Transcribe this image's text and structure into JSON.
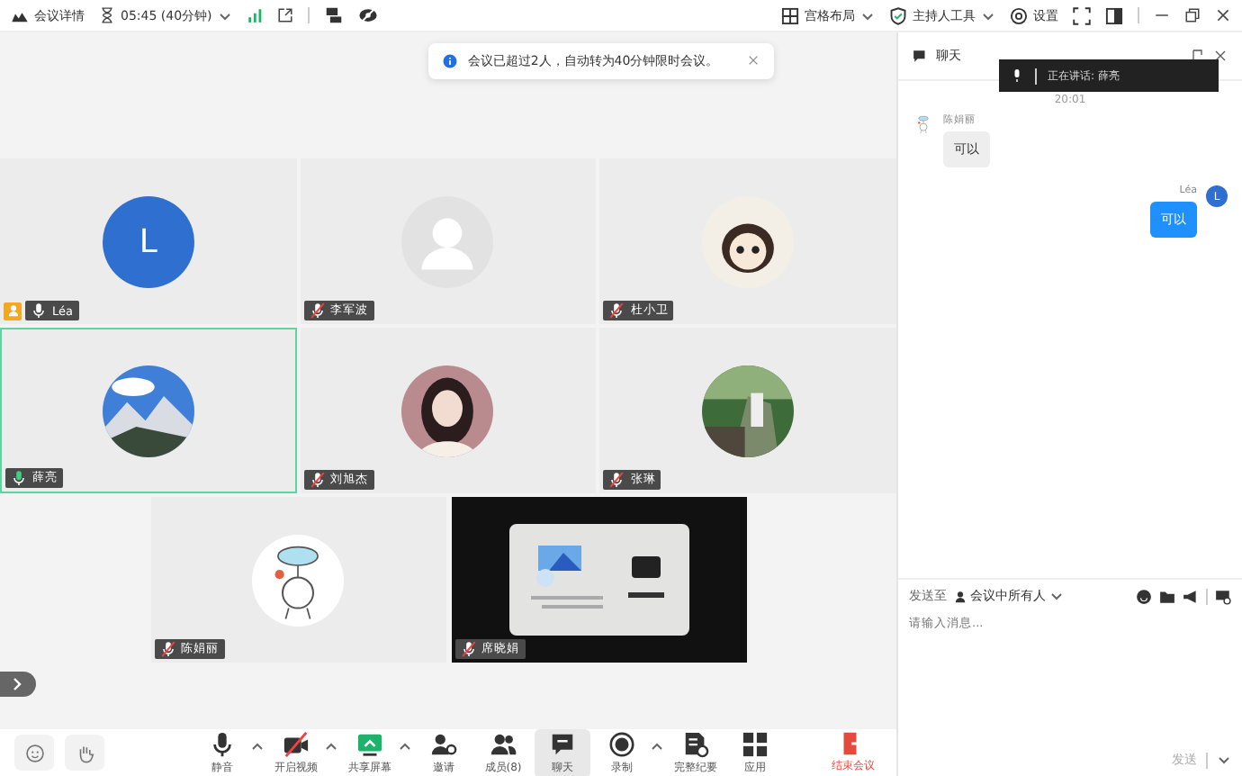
{
  "top_bar": {
    "meeting_info": "会议详情",
    "timer": "05:45 (40分钟)",
    "right_items": [
      {
        "label": "宫格布局"
      },
      {
        "label": "主持人工具"
      },
      {
        "label": "设置"
      }
    ]
  },
  "notice": {
    "text": "会议已超过2人，自动转为40分钟限时会议。"
  },
  "tiles": [
    {
      "name": "Léa",
      "kind": "letter",
      "letter": "L",
      "muted": false,
      "host": true,
      "speaking": false
    },
    {
      "name": "李军波",
      "kind": "default",
      "muted": true,
      "host": false,
      "speaking": false
    },
    {
      "name": "杜小卫",
      "kind": "picture",
      "muted": true,
      "host": false,
      "speaking": false
    },
    {
      "name": "薛亮",
      "kind": "picture",
      "muted": false,
      "host": false,
      "speaking": true
    },
    {
      "name": "刘旭杰",
      "kind": "picture",
      "muted": true,
      "host": false,
      "speaking": false
    },
    {
      "name": "张琳",
      "kind": "picture",
      "muted": true,
      "host": false,
      "speaking": false
    },
    {
      "name": "陈娟丽",
      "kind": "picture",
      "muted": true,
      "host": false,
      "speaking": false
    },
    {
      "name": "席晓娟",
      "kind": "screen",
      "muted": true,
      "host": false,
      "speaking": false
    }
  ],
  "toolbar": [
    {
      "label": "静音",
      "menu": true,
      "selected": false
    },
    {
      "label": "开启视频",
      "menu": true,
      "selected": false
    },
    {
      "label": "共享屏幕",
      "menu": true,
      "selected": false
    },
    {
      "label": "邀请",
      "menu": false,
      "selected": false
    },
    {
      "label": "成员(8)",
      "menu": false,
      "selected": false
    },
    {
      "label": "聊天",
      "menu": false,
      "selected": true
    },
    {
      "label": "录制",
      "menu": true,
      "selected": false
    },
    {
      "label": "完整纪要",
      "menu": false,
      "selected": false
    },
    {
      "label": "应用",
      "menu": false,
      "selected": false
    }
  ],
  "end_button": {
    "label": "结束会议"
  },
  "chat": {
    "title": "聊天",
    "speaking_toast": {
      "label": "正在讲话:",
      "name": "薛亮"
    },
    "time": "20:01",
    "messages": [
      {
        "sender": "陈娟丽",
        "text": "可以",
        "mine": false
      },
      {
        "sender": "Léa",
        "avatar_letter": "L",
        "text": "可以",
        "mine": true
      }
    ],
    "send_to_label": "发送至",
    "recipient": "会议中所有人",
    "placeholder": "请输入消息...",
    "send_button": {
      "label": "发送",
      "disabled": true
    }
  }
}
